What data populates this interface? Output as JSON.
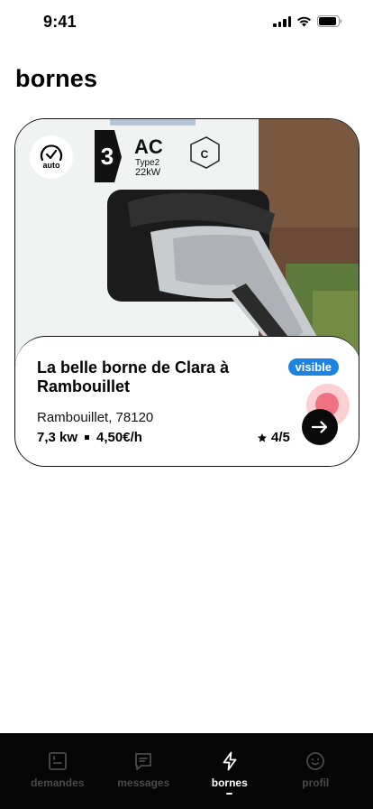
{
  "status_bar": {
    "time": "9:41"
  },
  "page": {
    "title": "bornes"
  },
  "borne_card": {
    "auto_label": "auto",
    "photo": {
      "plate_number": "3",
      "plate_type": "AC",
      "plate_subtype": "Type2",
      "plate_power": "22kW",
      "plate_connector": "C"
    },
    "title": "La belle borne de Clara à Rambouillet",
    "status_badge": "visible",
    "location": "Rambouillet, 78120",
    "power": "7,3 kw",
    "price": "4,50€/h",
    "rating": "4/5"
  },
  "tab_bar": {
    "tabs": [
      {
        "label": "demandes",
        "icon": "inbox-icon",
        "active": false
      },
      {
        "label": "messages",
        "icon": "chat-icon",
        "active": false
      },
      {
        "label": "bornes",
        "icon": "bolt-icon",
        "active": true
      },
      {
        "label": "profil",
        "icon": "smiley-icon",
        "active": false
      }
    ]
  },
  "colors": {
    "accent_blue": "#1a84e0",
    "tab_bar_bg": "#050505",
    "tab_inactive": "#4a4a4a"
  }
}
